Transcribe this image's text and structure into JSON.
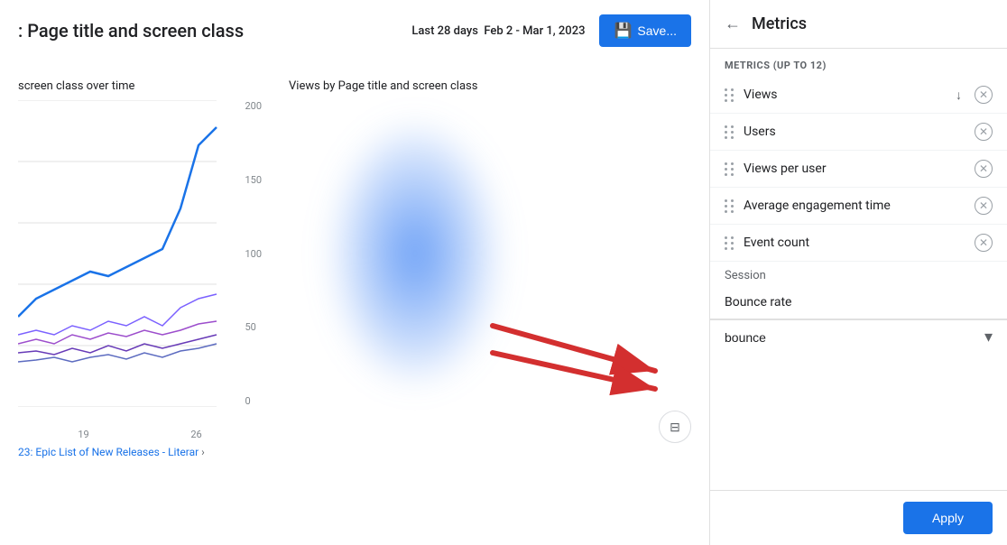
{
  "header": {
    "title": ": Page title and screen class",
    "date_label": "Last 28 days",
    "date_range": "Feb 2 - Mar 1, 2023",
    "save_label": "Save..."
  },
  "charts": {
    "left_title": "screen class over time",
    "right_title": "Views by Page title and screen class",
    "y_axis": [
      "200",
      "150",
      "100",
      "50",
      "0"
    ],
    "x_axis": [
      "19",
      "26"
    ]
  },
  "footer_text": "23: Epic List of New Releases - Literar",
  "metrics": {
    "panel_title": "Metrics",
    "section_label": "METRICS (UP TO 12)",
    "items": [
      {
        "label": "Views",
        "has_sort": true
      },
      {
        "label": "Users",
        "has_sort": false
      },
      {
        "label": "Views per user",
        "has_sort": false
      },
      {
        "label": "Average engagement time",
        "has_sort": false
      },
      {
        "label": "Event count",
        "has_sort": false
      }
    ],
    "group_label": "Session",
    "suggested_item": "Bounce rate",
    "dropdown_value": "bounce",
    "apply_label": "Apply"
  },
  "icons": {
    "back": "←",
    "save": "💾",
    "remove": "✕",
    "sort_down": "↓",
    "chevron_down": "▾",
    "feedback": "⊟"
  }
}
